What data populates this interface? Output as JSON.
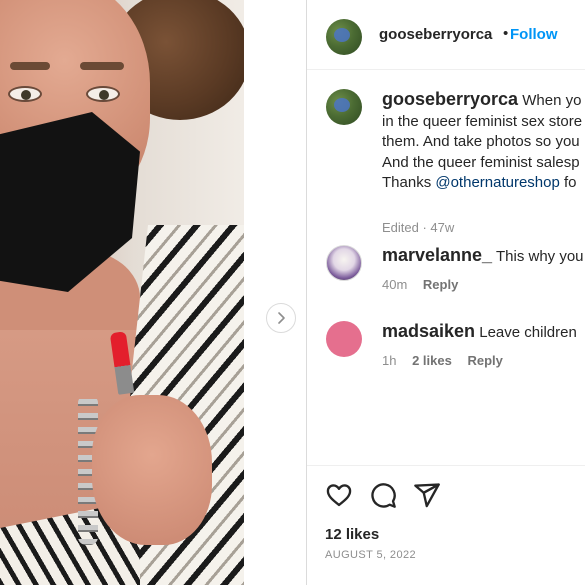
{
  "header": {
    "username": "gooseberryorca",
    "separator": "•",
    "follow_label": "Follow"
  },
  "caption": {
    "username": "gooseberryorca",
    "lines": [
      "When yo",
      "in the queer feminist sex store",
      "them. And take photos so you",
      "And the queer feminist salesp",
      "Thanks "
    ],
    "mention": "@othernatureshop",
    "mention_tail": " fo",
    "edited": "Edited · 47w"
  },
  "comments": [
    {
      "username": "marvelanne_",
      "text": "This why you",
      "age": "40m",
      "likes": "",
      "reply_label": "Reply"
    },
    {
      "username": "madsaiken",
      "text": "Leave children",
      "age": "1h",
      "likes": "2 likes",
      "reply_label": "Reply"
    }
  ],
  "footer": {
    "likes_label": "12 likes",
    "date": "AUGUST 5, 2022"
  },
  "colors": {
    "follow": "#0095f6",
    "mention": "#00376b",
    "text": "#262626",
    "muted": "#8e8e8e"
  },
  "icons": {
    "next": "chevron-right-icon",
    "like": "heart-icon",
    "comment": "comment-icon",
    "share": "share-icon"
  }
}
